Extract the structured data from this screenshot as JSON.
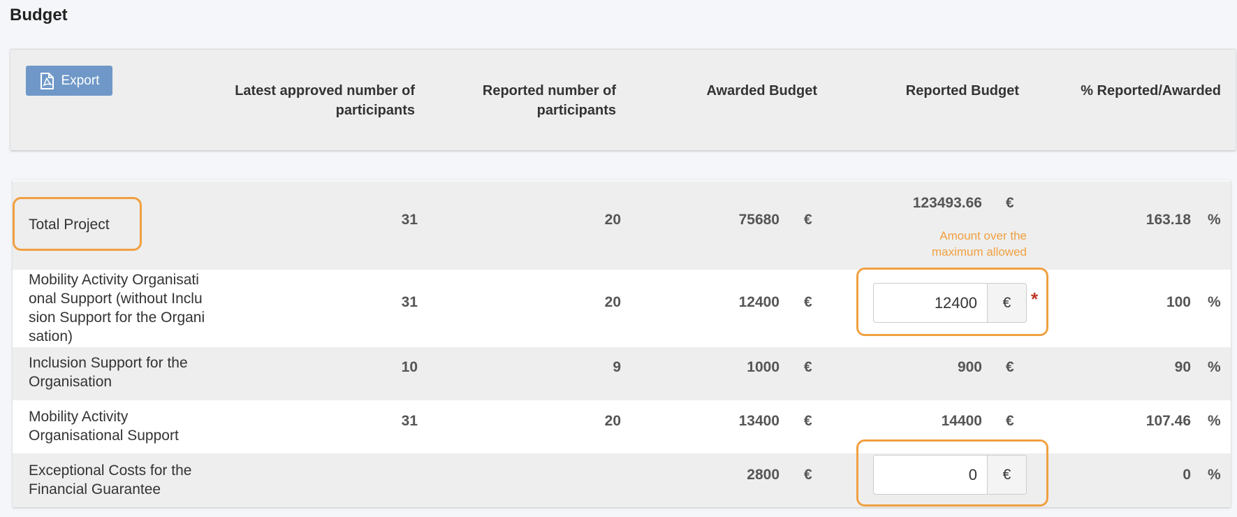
{
  "page": {
    "title": "Budget"
  },
  "toolbar": {
    "export_label": "Export",
    "export_icon": "pdf-file-icon"
  },
  "columns": {
    "approved": [
      "Latest approved number of",
      "participants"
    ],
    "reported": [
      "Reported number of",
      "participants"
    ],
    "awarded": "Awarded Budget",
    "reported_budget": "Reported Budget",
    "percent": "% Reported/Awarded"
  },
  "currency": "€",
  "percent_sign": "%",
  "rows": [
    {
      "label": "Total Project",
      "approved": "31",
      "reported": "20",
      "awarded": "75680",
      "reported_budget": "123493.66",
      "percent": "163.18",
      "warning": [
        "Amount over the",
        "maximum allowed"
      ]
    },
    {
      "label_lines": [
        "Mobility Activity Organisati",
        "onal Support (without Inclu",
        "sion Support for the Organi",
        "sation)"
      ],
      "approved": "31",
      "reported": "20",
      "awarded": "12400",
      "reported_budget_input": "12400",
      "required_mark": "*",
      "percent": "100"
    },
    {
      "label_lines": [
        "Inclusion Support for the",
        "Organisation"
      ],
      "approved": "10",
      "reported": "9",
      "awarded": "1000",
      "reported_budget": "900",
      "percent": "90"
    },
    {
      "label_lines": [
        "Mobility Activity",
        "Organisational Support"
      ],
      "approved": "31",
      "reported": "20",
      "awarded": "13400",
      "reported_budget": "14400",
      "percent": "107.46"
    },
    {
      "label_lines": [
        "Exceptional Costs for the",
        "Financial Guarantee"
      ],
      "approved": "",
      "reported": "",
      "awarded": "2800",
      "reported_budget_input": "0",
      "percent": "0"
    }
  ],
  "colors": {
    "accent_orange": "#f0a040",
    "export_blue": "#6f98c8",
    "required_red": "#c0392b"
  }
}
